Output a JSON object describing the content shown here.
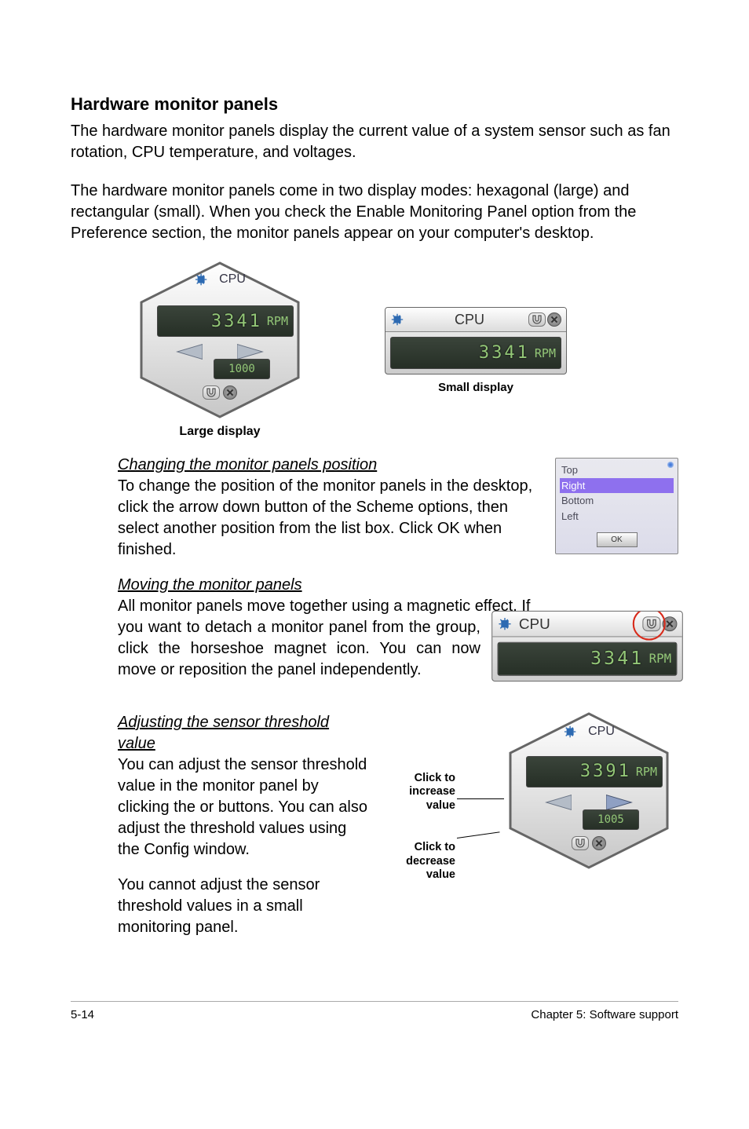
{
  "title": "Hardware monitor panels",
  "para1": "The hardware monitor panels display the current value of a system sensor such as fan rotation, CPU temperature, and voltages.",
  "para2": "The hardware monitor panels come in two display modes: hexagonal (large) and rectangular (small). When you check the Enable Monitoring Panel option from the Preference section, the monitor panels appear on your computer's desktop.",
  "large_panel": {
    "label": "CPU",
    "value": "3341",
    "unit": "RPM",
    "threshold": "1000"
  },
  "caption_large": "Large display",
  "small_panel": {
    "label": "CPU",
    "value": "3341",
    "unit": "RPM"
  },
  "caption_small": "Small display",
  "sub1": "Changing the monitor panels position",
  "sub1_text": "To change the position of the monitor panels in the desktop, click the arrow down button of the Scheme options, then select another position from the list box. Click OK when finished.",
  "sub2": "Moving the monitor panels",
  "sub2_text1": "All monitor panels move together using a magnetic effect. If",
  "sub2_text2": "you want to detach a monitor panel from the group, click the horseshoe magnet icon. You can now move or reposition the panel independently.",
  "detach_panel": {
    "label": "CPU",
    "value": "3341",
    "unit": "RPM"
  },
  "dropdown": {
    "items": [
      "Top",
      "Right",
      "Bottom",
      "Left"
    ],
    "selected": 1,
    "button": "OK"
  },
  "sub3": "Adjusting the sensor threshold value",
  "sub3_text1": "You can adjust the sensor threshold value in the monitor panel by clicking the  or  buttons. You can also adjust the threshold values using the Config window.",
  "sub3_text2": "You cannot adjust the sensor threshold values in a small monitoring panel.",
  "threshold_panel": {
    "label": "CPU",
    "value": "3391",
    "unit": "RPM",
    "threshold": "1005"
  },
  "click_increase": "Click to increase value",
  "click_decrease": "Click to decrease value",
  "footer_left": "5-14",
  "footer_right": "Chapter 5: Software support"
}
